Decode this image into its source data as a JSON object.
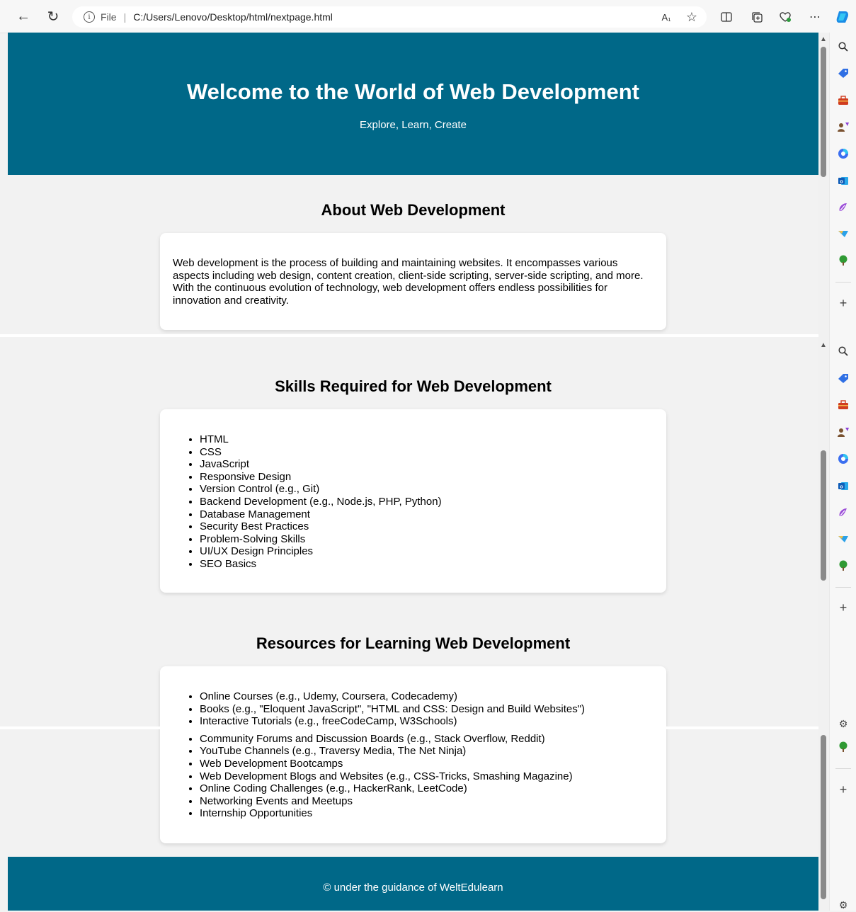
{
  "browser": {
    "file_label": "File",
    "url": "C:/Users/Lenovo/Desktop/html/nextpage.html"
  },
  "hero": {
    "title": "Welcome to the World of Web Development",
    "subtitle": "Explore, Learn, Create"
  },
  "about": {
    "heading": "About Web Development",
    "text": "Web development is the process of building and maintaining websites. It encompasses various aspects including web design, content creation, client-side scripting, server-side scripting, and more. With the continuous evolution of technology, web development offers endless possibilities for innovation and creativity."
  },
  "skills": {
    "heading": "Skills Required for Web Development",
    "items": [
      "HTML",
      "CSS",
      "JavaScript",
      "Responsive Design",
      "Version Control (e.g., Git)",
      "Backend Development (e.g., Node.js, PHP, Python)",
      "Database Management",
      "Security Best Practices",
      "Problem-Solving Skills",
      "UI/UX Design Principles",
      "SEO Basics"
    ]
  },
  "resources": {
    "heading": "Resources for Learning Web Development",
    "items": [
      "Online Courses (e.g., Udemy, Coursera, Codecademy)",
      "Books (e.g., \"Eloquent JavaScript\", \"HTML and CSS: Design and Build Websites\")",
      "Interactive Tutorials (e.g., freeCodeCamp, W3Schools)"
    ],
    "items_more": [
      "Community Forums and Discussion Boards (e.g., Stack Overflow, Reddit)",
      "YouTube Channels (e.g., Traversy Media, The Net Ninja)",
      "Web Development Bootcamps",
      "Web Development Blogs and Websites (e.g., CSS-Tricks, Smashing Magazine)",
      "Online Coding Challenges (e.g., HackerRank, LeetCode)",
      "Networking Events and Meetups",
      "Internship Opportunities"
    ]
  },
  "footer": {
    "text": "© under the guidance of WeltEdulearn"
  },
  "icons": {
    "toolbar": [
      "read-aloud-icon",
      "favorite-star-icon",
      "split-screen-icon",
      "collections-icon",
      "browser-essentials-icon",
      "more-icon",
      "copilot-icon"
    ],
    "sidebar": [
      "search-icon",
      "shopping-icon",
      "tools-icon",
      "games-icon",
      "microsoft365-icon",
      "outlook-icon",
      "designer-icon",
      "drop-icon",
      "tree-icon",
      "add-icon"
    ]
  },
  "colors": {
    "hero_bg": "#006888",
    "page_bg": "#f2f2f2",
    "card_bg": "#ffffff"
  }
}
